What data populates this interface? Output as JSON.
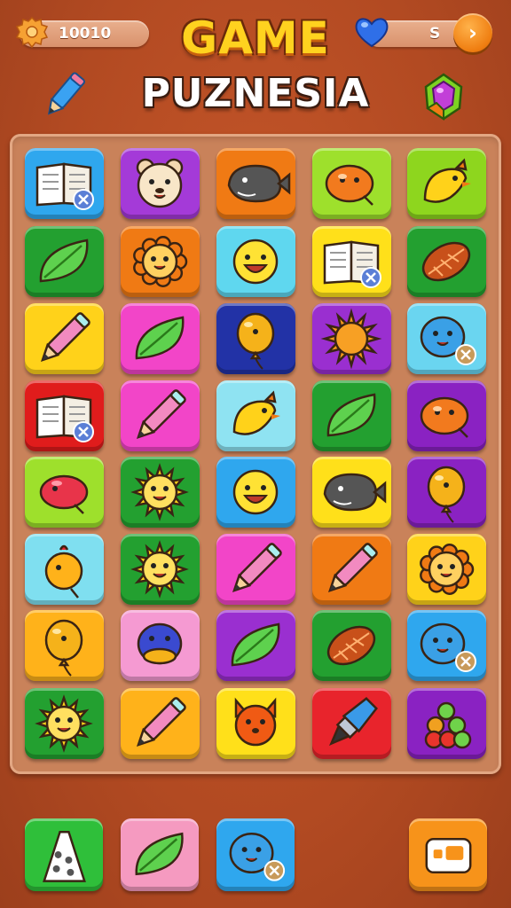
{
  "header": {
    "coins": "10010",
    "lives": "S",
    "title_line1": "GAME",
    "title_line2": "PUZNESIA"
  },
  "colors": {
    "background": "#b24a22",
    "board": "#c9825a",
    "title_yellow": "#ffd21f"
  },
  "board": {
    "rows": [
      [
        {
          "color": "#2fa7ee",
          "icon": "book-icon"
        },
        {
          "color": "#a43ad8",
          "icon": "bear-face-icon"
        },
        {
          "color": "#f07a14",
          "icon": "whale-icon"
        },
        {
          "color": "#9ee02c",
          "icon": "blob-icon"
        },
        {
          "color": "#8ed61e",
          "icon": "bird-icon"
        }
      ],
      [
        {
          "color": "#23a030",
          "icon": "leaf-icon"
        },
        {
          "color": "#f07a14",
          "icon": "lion-face-icon"
        },
        {
          "color": "#5fd7ef",
          "icon": "smiley-face-icon"
        },
        {
          "color": "#ffe01a",
          "icon": "book-icon"
        },
        {
          "color": "#23a030",
          "icon": "seed-icon"
        }
      ],
      [
        {
          "color": "#ffd21a",
          "icon": "pencil-icon"
        },
        {
          "color": "#f245c8",
          "icon": "leaf-icon"
        },
        {
          "color": "#2232a6",
          "icon": "balloon-icon"
        },
        {
          "color": "#9a2fd0",
          "icon": "sun-icon"
        },
        {
          "color": "#6ad5f0",
          "icon": "blob-face-icon"
        }
      ],
      [
        {
          "color": "#e01c1c",
          "icon": "book-icon"
        },
        {
          "color": "#f245c8",
          "icon": "pencil-icon"
        },
        {
          "color": "#8fe3f2",
          "icon": "bird-icon"
        },
        {
          "color": "#23a030",
          "icon": "leaf-icon"
        },
        {
          "color": "#8a22c2",
          "icon": "blob-icon"
        }
      ],
      [
        {
          "color": "#9ee02c",
          "icon": "fish-icon"
        },
        {
          "color": "#23a030",
          "icon": "sun-face-icon"
        },
        {
          "color": "#2fa7ee",
          "icon": "smiley-face-icon"
        },
        {
          "color": "#ffe01a",
          "icon": "whale-icon"
        },
        {
          "color": "#8a22c2",
          "icon": "balloon-icon"
        }
      ],
      [
        {
          "color": "#7fdff0",
          "icon": "chick-icon"
        },
        {
          "color": "#23a030",
          "icon": "sun-face-icon"
        },
        {
          "color": "#f245c8",
          "icon": "pencil-icon"
        },
        {
          "color": "#f07a14",
          "icon": "pencil-icon"
        },
        {
          "color": "#ffd21a",
          "icon": "lion-face-icon"
        }
      ],
      [
        {
          "color": "#ffb21a",
          "icon": "balloon-icon"
        },
        {
          "color": "#f59ad2",
          "icon": "fish-face-icon"
        },
        {
          "color": "#9a2fd0",
          "icon": "leaf-icon"
        },
        {
          "color": "#23a030",
          "icon": "seed-icon"
        },
        {
          "color": "#2fa7ee",
          "icon": "blob-face-icon"
        }
      ],
      [
        {
          "color": "#23a030",
          "icon": "sun-face-icon"
        },
        {
          "color": "#ffb21a",
          "icon": "pencil-icon"
        },
        {
          "color": "#ffe01a",
          "icon": "fox-face-icon"
        },
        {
          "color": "#e8242c",
          "icon": "pen-icon"
        },
        {
          "color": "#8a22c2",
          "icon": "gems-icon"
        }
      ]
    ]
  },
  "bottom_bar": [
    {
      "color": "#2fbf3a",
      "icon": "letter-a-icon"
    },
    {
      "color": "#f59ac0",
      "icon": "leaf-icon"
    },
    {
      "color": "#2fa7ee",
      "icon": "blob-face-icon"
    },
    {
      "color": "#f7931a",
      "icon": "screen-icon"
    }
  ]
}
